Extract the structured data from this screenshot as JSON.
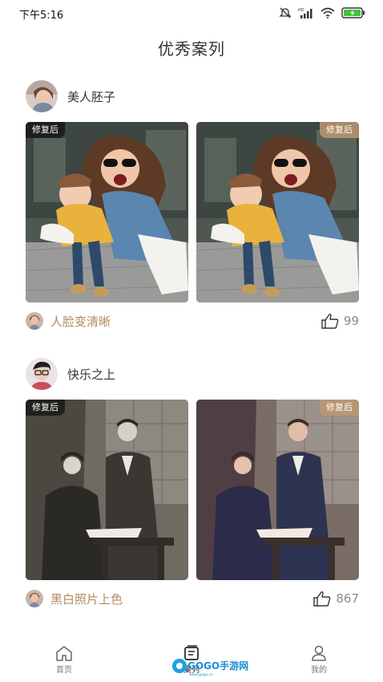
{
  "status_bar": {
    "time": "下午5:16",
    "net_label": "HD",
    "icons": [
      "mute-icon",
      "signal-icon",
      "wifi-icon",
      "battery-icon"
    ]
  },
  "page": {
    "title": "优秀案列"
  },
  "cases": [
    {
      "user_name": "美人胚子",
      "before_tag": "修复后",
      "after_tag": "修复后",
      "feature_label": "人脸变清晰",
      "like_count": "99"
    },
    {
      "user_name": "快乐之上",
      "before_tag": "修复后",
      "after_tag": "修复后",
      "feature_label": "黑白照片上色",
      "like_count": "867"
    }
  ],
  "tab_bar": {
    "tabs": [
      {
        "label": "首页",
        "icon": "home-icon",
        "active": false
      },
      {
        "label": "案列",
        "icon": "cases-icon",
        "active": true
      },
      {
        "label": "我的",
        "icon": "profile-icon",
        "active": false
      }
    ]
  },
  "watermark": {
    "text": "GOGO手游网",
    "sub": "www.gogo.cn"
  },
  "colors": {
    "accent": "#b48a5f",
    "tag_right": "#bc966e",
    "tag_left": "#000000"
  }
}
